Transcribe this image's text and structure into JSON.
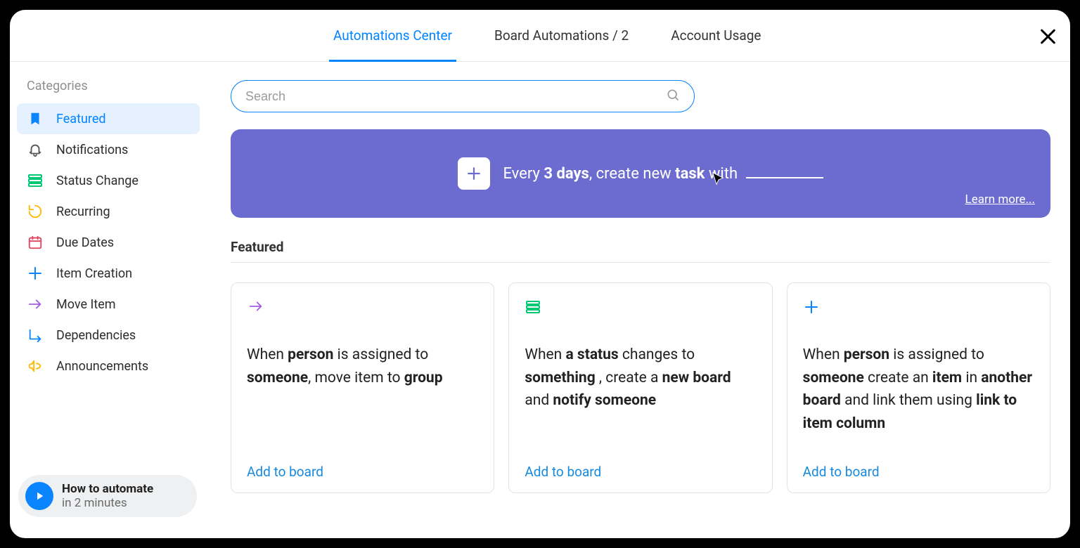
{
  "header": {
    "tabs": [
      {
        "label": "Automations Center",
        "active": true
      },
      {
        "label": "Board Automations / 2",
        "active": false
      },
      {
        "label": "Account Usage",
        "active": false
      }
    ]
  },
  "sidebar": {
    "title": "Categories",
    "items": [
      {
        "label": "Featured",
        "icon": "bookmark-icon",
        "color": "#0a84ff",
        "active": true
      },
      {
        "label": "Notifications",
        "icon": "bell-icon",
        "color": "#555555",
        "active": false
      },
      {
        "label": "Status Change",
        "icon": "status-icon",
        "color": "#00c875",
        "active": false
      },
      {
        "label": "Recurring",
        "icon": "recurring-icon",
        "color": "#ffb700",
        "active": false
      },
      {
        "label": "Due Dates",
        "icon": "calendar-icon",
        "color": "#e2445c",
        "active": false
      },
      {
        "label": "Item Creation",
        "icon": "plus-icon",
        "color": "#0a84ff",
        "active": false
      },
      {
        "label": "Move Item",
        "icon": "arrow-right-icon",
        "color": "#a25ddc",
        "active": false
      },
      {
        "label": "Dependencies",
        "icon": "dependencies-icon",
        "color": "#0a84ff",
        "active": false
      },
      {
        "label": "Announcements",
        "icon": "megaphone-icon",
        "color": "#ffb700",
        "active": false
      }
    ],
    "howto": {
      "title": "How to automate",
      "subtitle": "in 2 minutes"
    }
  },
  "search": {
    "placeholder": "Search"
  },
  "banner": {
    "prefix": "Every ",
    "bold1": "3 days",
    "mid": ", create new ",
    "bold2": "task",
    "suffix": " with ",
    "learn_more": "Learn more..."
  },
  "section_title": "Featured",
  "cards": [
    {
      "icon": "arrow-right-icon",
      "icon_color": "#a25ddc",
      "parts": [
        "When ",
        "person",
        " is assigned to ",
        "someone",
        ", move item to ",
        "group"
      ],
      "bold": [
        false,
        true,
        false,
        true,
        false,
        true
      ],
      "action": "Add to board"
    },
    {
      "icon": "status-icon",
      "icon_color": "#00c875",
      "parts": [
        "When ",
        "a status",
        " changes to ",
        "something",
        " , create a ",
        "new board",
        " and ",
        "notify someone"
      ],
      "bold": [
        false,
        true,
        false,
        true,
        false,
        true,
        false,
        true
      ],
      "action": "Add to board"
    },
    {
      "icon": "plus-icon",
      "icon_color": "#0a84ff",
      "parts": [
        "When ",
        "person",
        " is assigned to ",
        "someone",
        " create an ",
        "item",
        " in ",
        "another board",
        " and link them using ",
        "link to item column"
      ],
      "bold": [
        false,
        true,
        false,
        true,
        false,
        true,
        false,
        true,
        false,
        true
      ],
      "action": "Add to board"
    }
  ]
}
